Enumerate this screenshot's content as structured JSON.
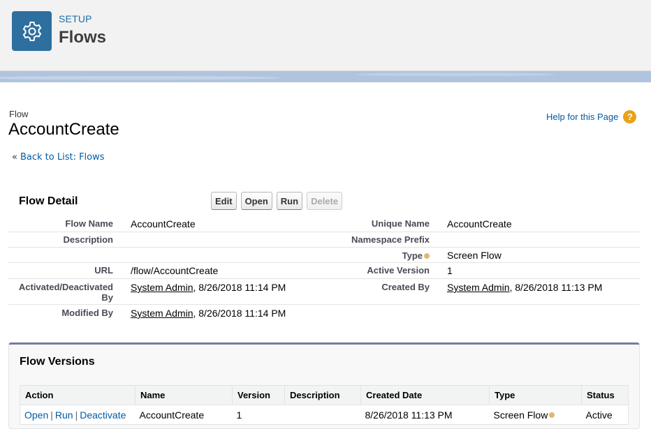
{
  "header": {
    "setup_label": "SETUP",
    "title": "Flows",
    "icon": "gear-icon"
  },
  "page": {
    "object_type": "Flow",
    "object_name": "AccountCreate",
    "help_link": "Help for this Page",
    "back_prefix": "«",
    "back_link": "Back to List: Flows"
  },
  "detail": {
    "title": "Flow Detail",
    "buttons": {
      "edit": "Edit",
      "open": "Open",
      "run": "Run",
      "delete": "Delete"
    },
    "fields": {
      "flow_name_label": "Flow Name",
      "flow_name": "AccountCreate",
      "unique_name_label": "Unique Name",
      "unique_name": "AccountCreate",
      "description_label": "Description",
      "namespace_label": "Namespace Prefix",
      "type_label": "Type",
      "type": "Screen Flow",
      "url_label": "URL",
      "url": "/flow/AccountCreate",
      "active_version_label": "Active Version",
      "active_version": "1",
      "activated_label": "Activated/Deactivated By",
      "activated_by": "System Admin",
      "activated_date": ", 8/26/2018 11:14 PM",
      "created_label": "Created By",
      "created_by": "System Admin",
      "created_date": ", 8/26/2018 11:13 PM",
      "modified_label": "Modified By",
      "modified_by": "System Admin",
      "modified_date": ", 8/26/2018 11:14 PM"
    }
  },
  "versions": {
    "title": "Flow Versions",
    "columns": [
      "Action",
      "Name",
      "Version",
      "Description",
      "Created Date",
      "Type",
      "Status"
    ],
    "rows": [
      {
        "actions": [
          "Open",
          "Run",
          "Deactivate"
        ],
        "separator": "|",
        "name": "AccountCreate",
        "version": "1",
        "description": "",
        "created_date": "8/26/2018 11:13 PM",
        "type": "Screen Flow",
        "status": "Active"
      }
    ]
  }
}
